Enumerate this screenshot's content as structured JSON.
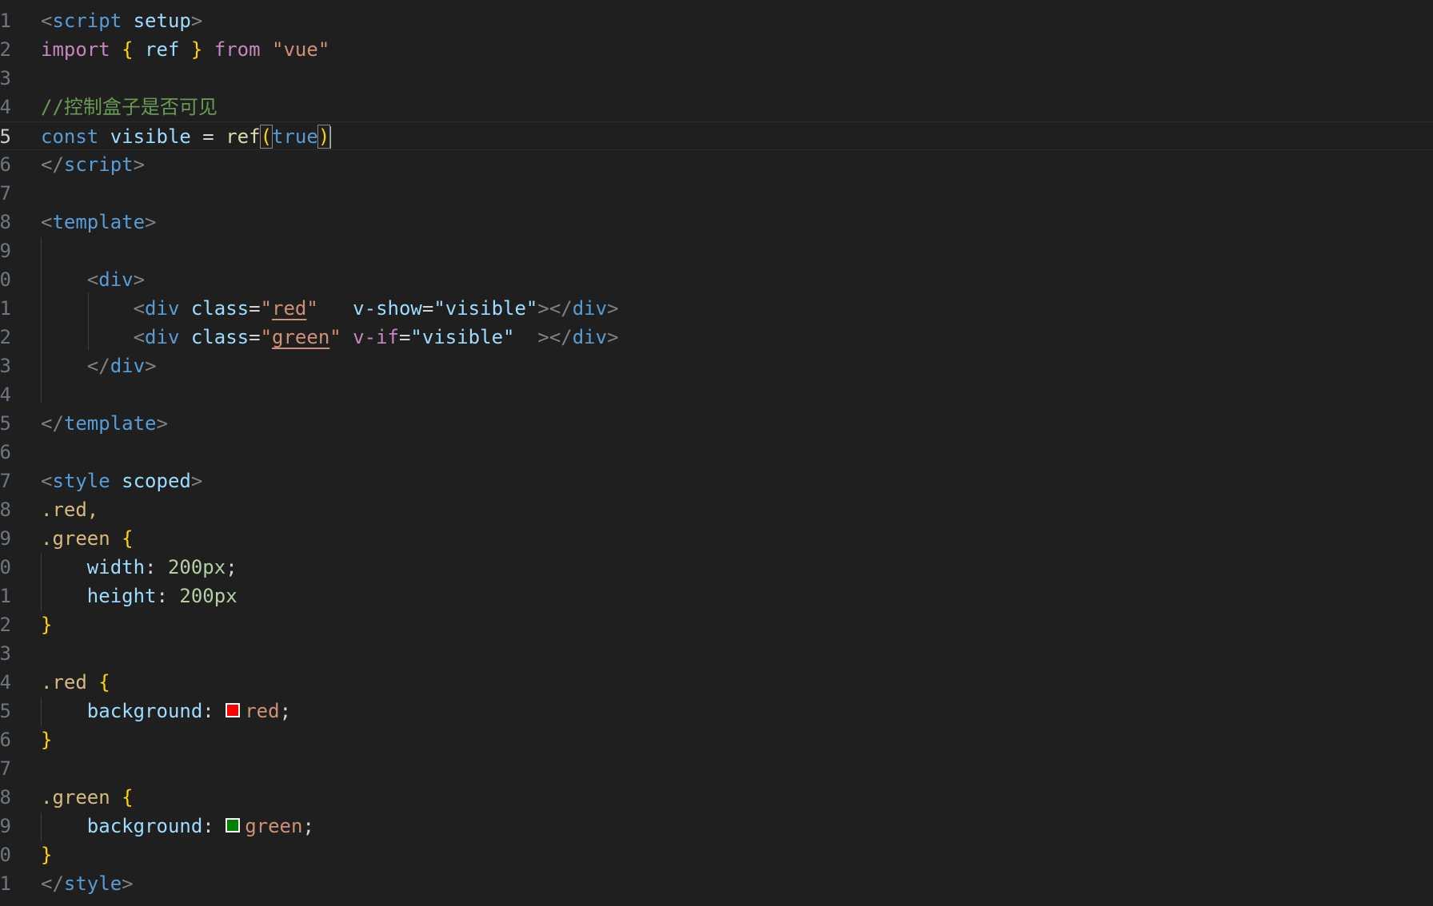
{
  "editor": {
    "gutter": {
      "l1": "1",
      "l2": "2",
      "l3": "3",
      "l4": "4",
      "l5": "5",
      "l6": "6",
      "l7": "7",
      "l8": "8",
      "l9": "9",
      "l10": "0",
      "l11": "1",
      "l12": "2",
      "l13": "3",
      "l14": "4",
      "l15": "5",
      "l16": "6",
      "l17": "7",
      "l18": "8",
      "l19": "9",
      "l20": "0",
      "l21": "1",
      "l22": "2",
      "l23": "3",
      "l24": "4",
      "l25": "5",
      "l26": "6",
      "l27": "7",
      "l28": "8",
      "l29": "9",
      "l30": "0",
      "l31": "1"
    },
    "line1": {
      "lt": "<",
      "tag": "script",
      "attr": " setup",
      "gt": ">"
    },
    "line2": {
      "kw_import": "import",
      "sp1": " ",
      "lbrace": "{",
      "ref": " ref ",
      "rbrace": "}",
      "sp2": " ",
      "kw_from": "from",
      "sp3": " ",
      "str_vue": "\"vue\""
    },
    "line4": {
      "comment": "//控制盒子是否可见"
    },
    "line5": {
      "kw_const": "const",
      "var": " visible",
      "eq": " = ",
      "fn": "ref",
      "lparen": "(",
      "bool": "true",
      "rparen": ")"
    },
    "line6": {
      "lt": "</",
      "tag": "script",
      "gt": ">"
    },
    "line8": {
      "lt": "<",
      "tag": "template",
      "gt": ">"
    },
    "line10": {
      "indent": "    ",
      "lt": "<",
      "tag": "div",
      "gt": ">"
    },
    "line11": {
      "indent": "        ",
      "lt": "<",
      "tag": "div",
      "attr_class": " class",
      "eq1": "=",
      "q1": "\"",
      "class_val": "red",
      "q2": "\"",
      "attr_vshow": "   v-show",
      "eq2": "=",
      "dir_val": "\"visible\"",
      "gt": ">",
      "close_lt": "</",
      "close_tag": "div",
      "close_gt": ">"
    },
    "line12": {
      "indent": "        ",
      "lt": "<",
      "tag": "div",
      "attr_class": " class",
      "eq1": "=",
      "q1": "\"",
      "class_val": "green",
      "q2": "\"",
      "attr_vif": " v-if",
      "eq2": "=",
      "dir_val": "\"visible\"",
      "gt": "  >",
      "close_lt": "</",
      "close_tag": "div",
      "close_gt": ">"
    },
    "line13": {
      "indent": "    ",
      "lt": "</",
      "tag": "div",
      "gt": ">"
    },
    "line15": {
      "lt": "</",
      "tag": "template",
      "gt": ">"
    },
    "line17": {
      "lt": "<",
      "tag": "style",
      "attr": " scoped",
      "gt": ">"
    },
    "line18": {
      "selector": ".red,"
    },
    "line19": {
      "selector": ".green ",
      "brace": "{"
    },
    "line20": {
      "indent": "    ",
      "prop": "width",
      "colon": ": ",
      "value": "200px",
      "semi": ";"
    },
    "line21": {
      "indent": "    ",
      "prop": "height",
      "colon": ": ",
      "value": "200px"
    },
    "line22": {
      "brace": "}"
    },
    "line24": {
      "selector": ".red ",
      "brace": "{"
    },
    "line25": {
      "indent": "    ",
      "prop": "background",
      "colon": ": ",
      "value": "red",
      "semi": ";"
    },
    "line26": {
      "brace": "}"
    },
    "line28": {
      "selector": ".green ",
      "brace": "{"
    },
    "line29": {
      "indent": "    ",
      "prop": "background",
      "colon": ": ",
      "value": "green",
      "semi": ";"
    },
    "line30": {
      "brace": "}"
    },
    "line31": {
      "lt": "</",
      "tag": "style",
      "gt": ">"
    }
  },
  "colors": {
    "background": "#1f1f1f",
    "swatch_red": "#ff0000",
    "swatch_green": "#008000"
  }
}
